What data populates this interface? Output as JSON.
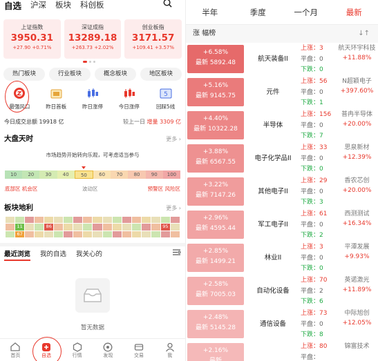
{
  "left": {
    "topnav": [
      "自选",
      "沪深",
      "板块",
      "科创板"
    ],
    "indices": [
      {
        "name": "上证指数",
        "value": "3950.31",
        "change": "+27.90 +0.71%"
      },
      {
        "name": "深证成指",
        "value": "13289.18",
        "change": "+263.73 +2.02%"
      },
      {
        "name": "创业板指",
        "value": "3171.57",
        "change": "+109.41 +3.57%"
      }
    ],
    "tabs": [
      "热门板块",
      "行业板块",
      "概念板块",
      "地区板块"
    ],
    "icons": [
      {
        "label": "最强风口",
        "icon": "fire-clock-icon"
      },
      {
        "label": "昨日首板",
        "icon": "calendar-icon"
      },
      {
        "label": "昨日涨停",
        "icon": "candlestick-icon"
      },
      {
        "label": "今日涨停",
        "icon": "candlestick-red-icon"
      },
      {
        "label": "回踩5线",
        "icon": "chart-line-icon"
      }
    ],
    "volume": {
      "label": "今日成交总额",
      "value": "19918 亿",
      "compare_label": "较上一日",
      "compare_value": "增量 3309 亿"
    },
    "mood": {
      "title": "大盘天时",
      "more": "更多",
      "text": "市场趋势开始转向乐观，可考虑适当参与",
      "scale": [
        "10",
        "20",
        "30",
        "40",
        "50",
        "60",
        "70",
        "80",
        "90",
        "100"
      ],
      "level": 0.5,
      "labels": [
        "底部区 机会区",
        "波动区",
        "预警区 风险区"
      ]
    },
    "sector": {
      "title": "板块地利",
      "more": "更多",
      "cells": [
        "11",
        "86",
        "95",
        "67"
      ]
    },
    "recent": {
      "tabs": [
        "最近浏览",
        "我的自选",
        "我关心的"
      ],
      "empty": "暂无数据"
    },
    "bottom": [
      "首页",
      "自选",
      "行情",
      "发现",
      "交易",
      "我"
    ]
  },
  "right": {
    "periods": [
      "半年",
      "季度",
      "一个月",
      "最新"
    ],
    "header": "涨 幅榜",
    "rows": [
      {
        "pct": "+6.58%",
        "latest": "最新 5892.48",
        "name": "航天装备II",
        "up": "3",
        "flat": "0",
        "down": "0",
        "lead": "航天环宇科技",
        "lead_pct": "+11.88%"
      },
      {
        "pct": "+5.16%",
        "latest": "最新 9145.75",
        "name": "元件",
        "up": "56",
        "flat": "0",
        "down": "1",
        "lead": "N超颖电子",
        "lead_pct": "+397.60%"
      },
      {
        "pct": "+4.40%",
        "latest": "最新 10322.28",
        "name": "半导体",
        "up": "156",
        "flat": "0",
        "down": "7",
        "lead": "普冉半导体",
        "lead_pct": "+20.00%"
      },
      {
        "pct": "+3.88%",
        "latest": "最新 6567.55",
        "name": "电子化学品II",
        "up": "33",
        "flat": "0",
        "down": "0",
        "lead": "思泉新材",
        "lead_pct": "+12.39%"
      },
      {
        "pct": "+3.22%",
        "latest": "最新 7147.26",
        "name": "其他电子II",
        "up": "29",
        "flat": "0",
        "down": "3",
        "lead": "香农芯创",
        "lead_pct": "+20.00%"
      },
      {
        "pct": "+2.96%",
        "latest": "最新 4595.44",
        "name": "军工电子II",
        "up": "61",
        "flat": "0",
        "down": "2",
        "lead": "西测测试",
        "lead_pct": "+16.34%"
      },
      {
        "pct": "+2.85%",
        "latest": "最新 1499.21",
        "name": "林业II",
        "up": "3",
        "flat": "0",
        "down": "0",
        "lead": "平潭发展",
        "lead_pct": "+9.93%"
      },
      {
        "pct": "+2.58%",
        "latest": "最新 7005.03",
        "name": "自动化设备",
        "up": "70",
        "flat": "2",
        "down": "6",
        "lead": "英诺激光",
        "lead_pct": "+11.89%"
      },
      {
        "pct": "+2.48%",
        "latest": "最新 5145.28",
        "name": "通信设备",
        "up": "73",
        "flat": "0",
        "down": "8",
        "lead": "中际旭创",
        "lead_pct": "+12.05%"
      },
      {
        "pct": "+2.16%",
        "latest": "最新",
        "name": "",
        "up": "80",
        "flat": "",
        "down": "",
        "lead": "锦富技术",
        "lead_pct": ""
      }
    ],
    "labels": {
      "up": "上涨：",
      "flat": "平盘：",
      "down": "下跌："
    }
  },
  "colors": {
    "red": "#e8382c",
    "green": "#1faa43"
  }
}
